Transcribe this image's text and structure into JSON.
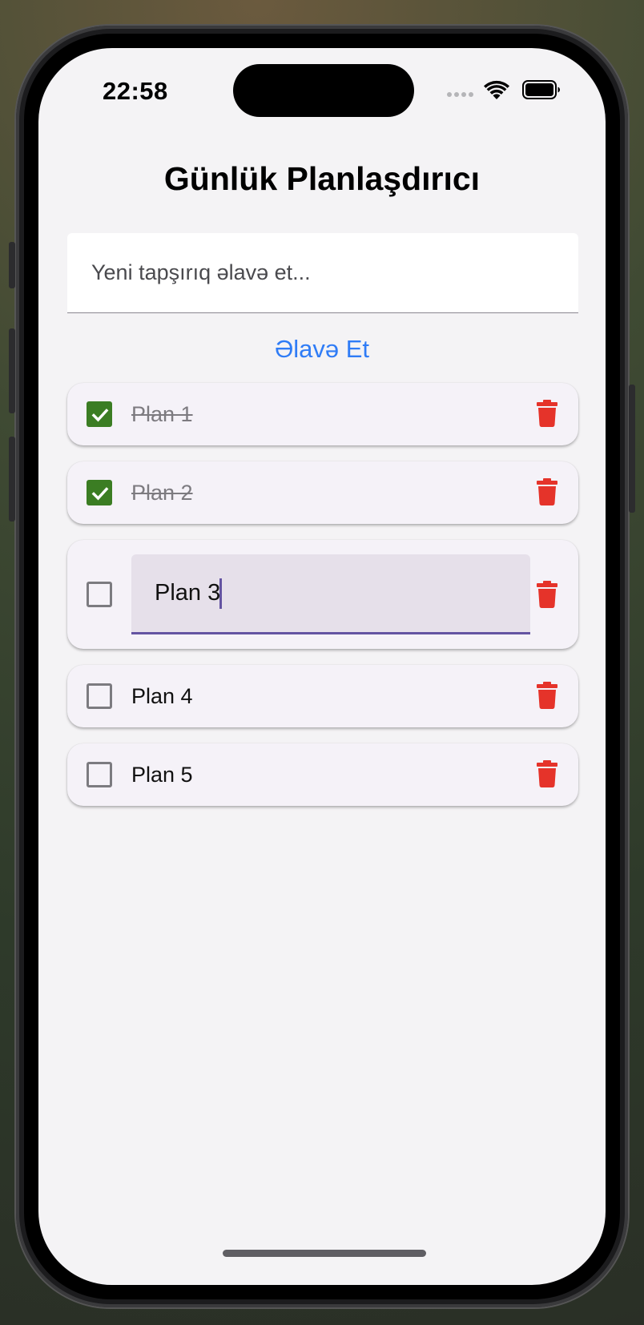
{
  "status_bar": {
    "time": "22:58"
  },
  "title": "Günlük Planlaşdırıcı",
  "new_task": {
    "placeholder": "Yeni tapşırıq əlavə et...",
    "value": ""
  },
  "add_button": {
    "label": "Əlavə Et"
  },
  "tasks": [
    {
      "label": "Plan 1",
      "done": true,
      "editing": false
    },
    {
      "label": "Plan 2",
      "done": true,
      "editing": false
    },
    {
      "label": "Plan 3",
      "done": false,
      "editing": true
    },
    {
      "label": "Plan 4",
      "done": false,
      "editing": false
    },
    {
      "label": "Plan 5",
      "done": false,
      "editing": false
    }
  ],
  "colors": {
    "accent": "#2f7cf6",
    "checked": "#3b7d23",
    "delete": "#e5332a",
    "edit_underline": "#6454a2",
    "background": "#f4f3f5"
  },
  "icons": {
    "checkbox_checked": "check-icon",
    "delete": "trash-icon",
    "wifi": "wifi-icon",
    "battery": "battery-icon"
  }
}
